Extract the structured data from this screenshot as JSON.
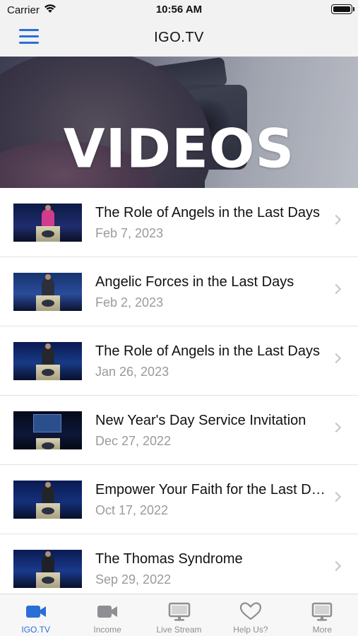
{
  "status_bar": {
    "carrier": "Carrier",
    "time": "10:56 AM"
  },
  "nav": {
    "title": "IGO.TV"
  },
  "hero": {
    "title": "VIDEOS"
  },
  "videos": [
    {
      "title": "The Role of Angels in the Last Days",
      "date": "Feb 7, 2023"
    },
    {
      "title": "Angelic Forces in the Last Days",
      "date": "Feb 2, 2023"
    },
    {
      "title": "The Role of Angels in the Last Days",
      "date": "Jan 26, 2023"
    },
    {
      "title": "New Year's Day Service Invitation",
      "date": "Dec 27, 2022"
    },
    {
      "title": "Empower Your Faith for the Last Days",
      "date": "Oct 17, 2022"
    },
    {
      "title": "The Thomas Syndrome",
      "date": "Sep 29, 2022"
    }
  ],
  "tabs": [
    {
      "label": "IGO.TV",
      "icon": "video-camera-icon",
      "active": true
    },
    {
      "label": "Income",
      "icon": "video-camera-icon",
      "active": false
    },
    {
      "label": "Live Stream",
      "icon": "monitor-icon",
      "active": false
    },
    {
      "label": "Help Us?",
      "icon": "heart-icon",
      "active": false
    },
    {
      "label": "More",
      "icon": "monitor-icon",
      "active": false
    }
  ],
  "colors": {
    "accent": "#2a6fd6",
    "inactive": "#8e8e93",
    "date_text": "#9a9a9f"
  }
}
